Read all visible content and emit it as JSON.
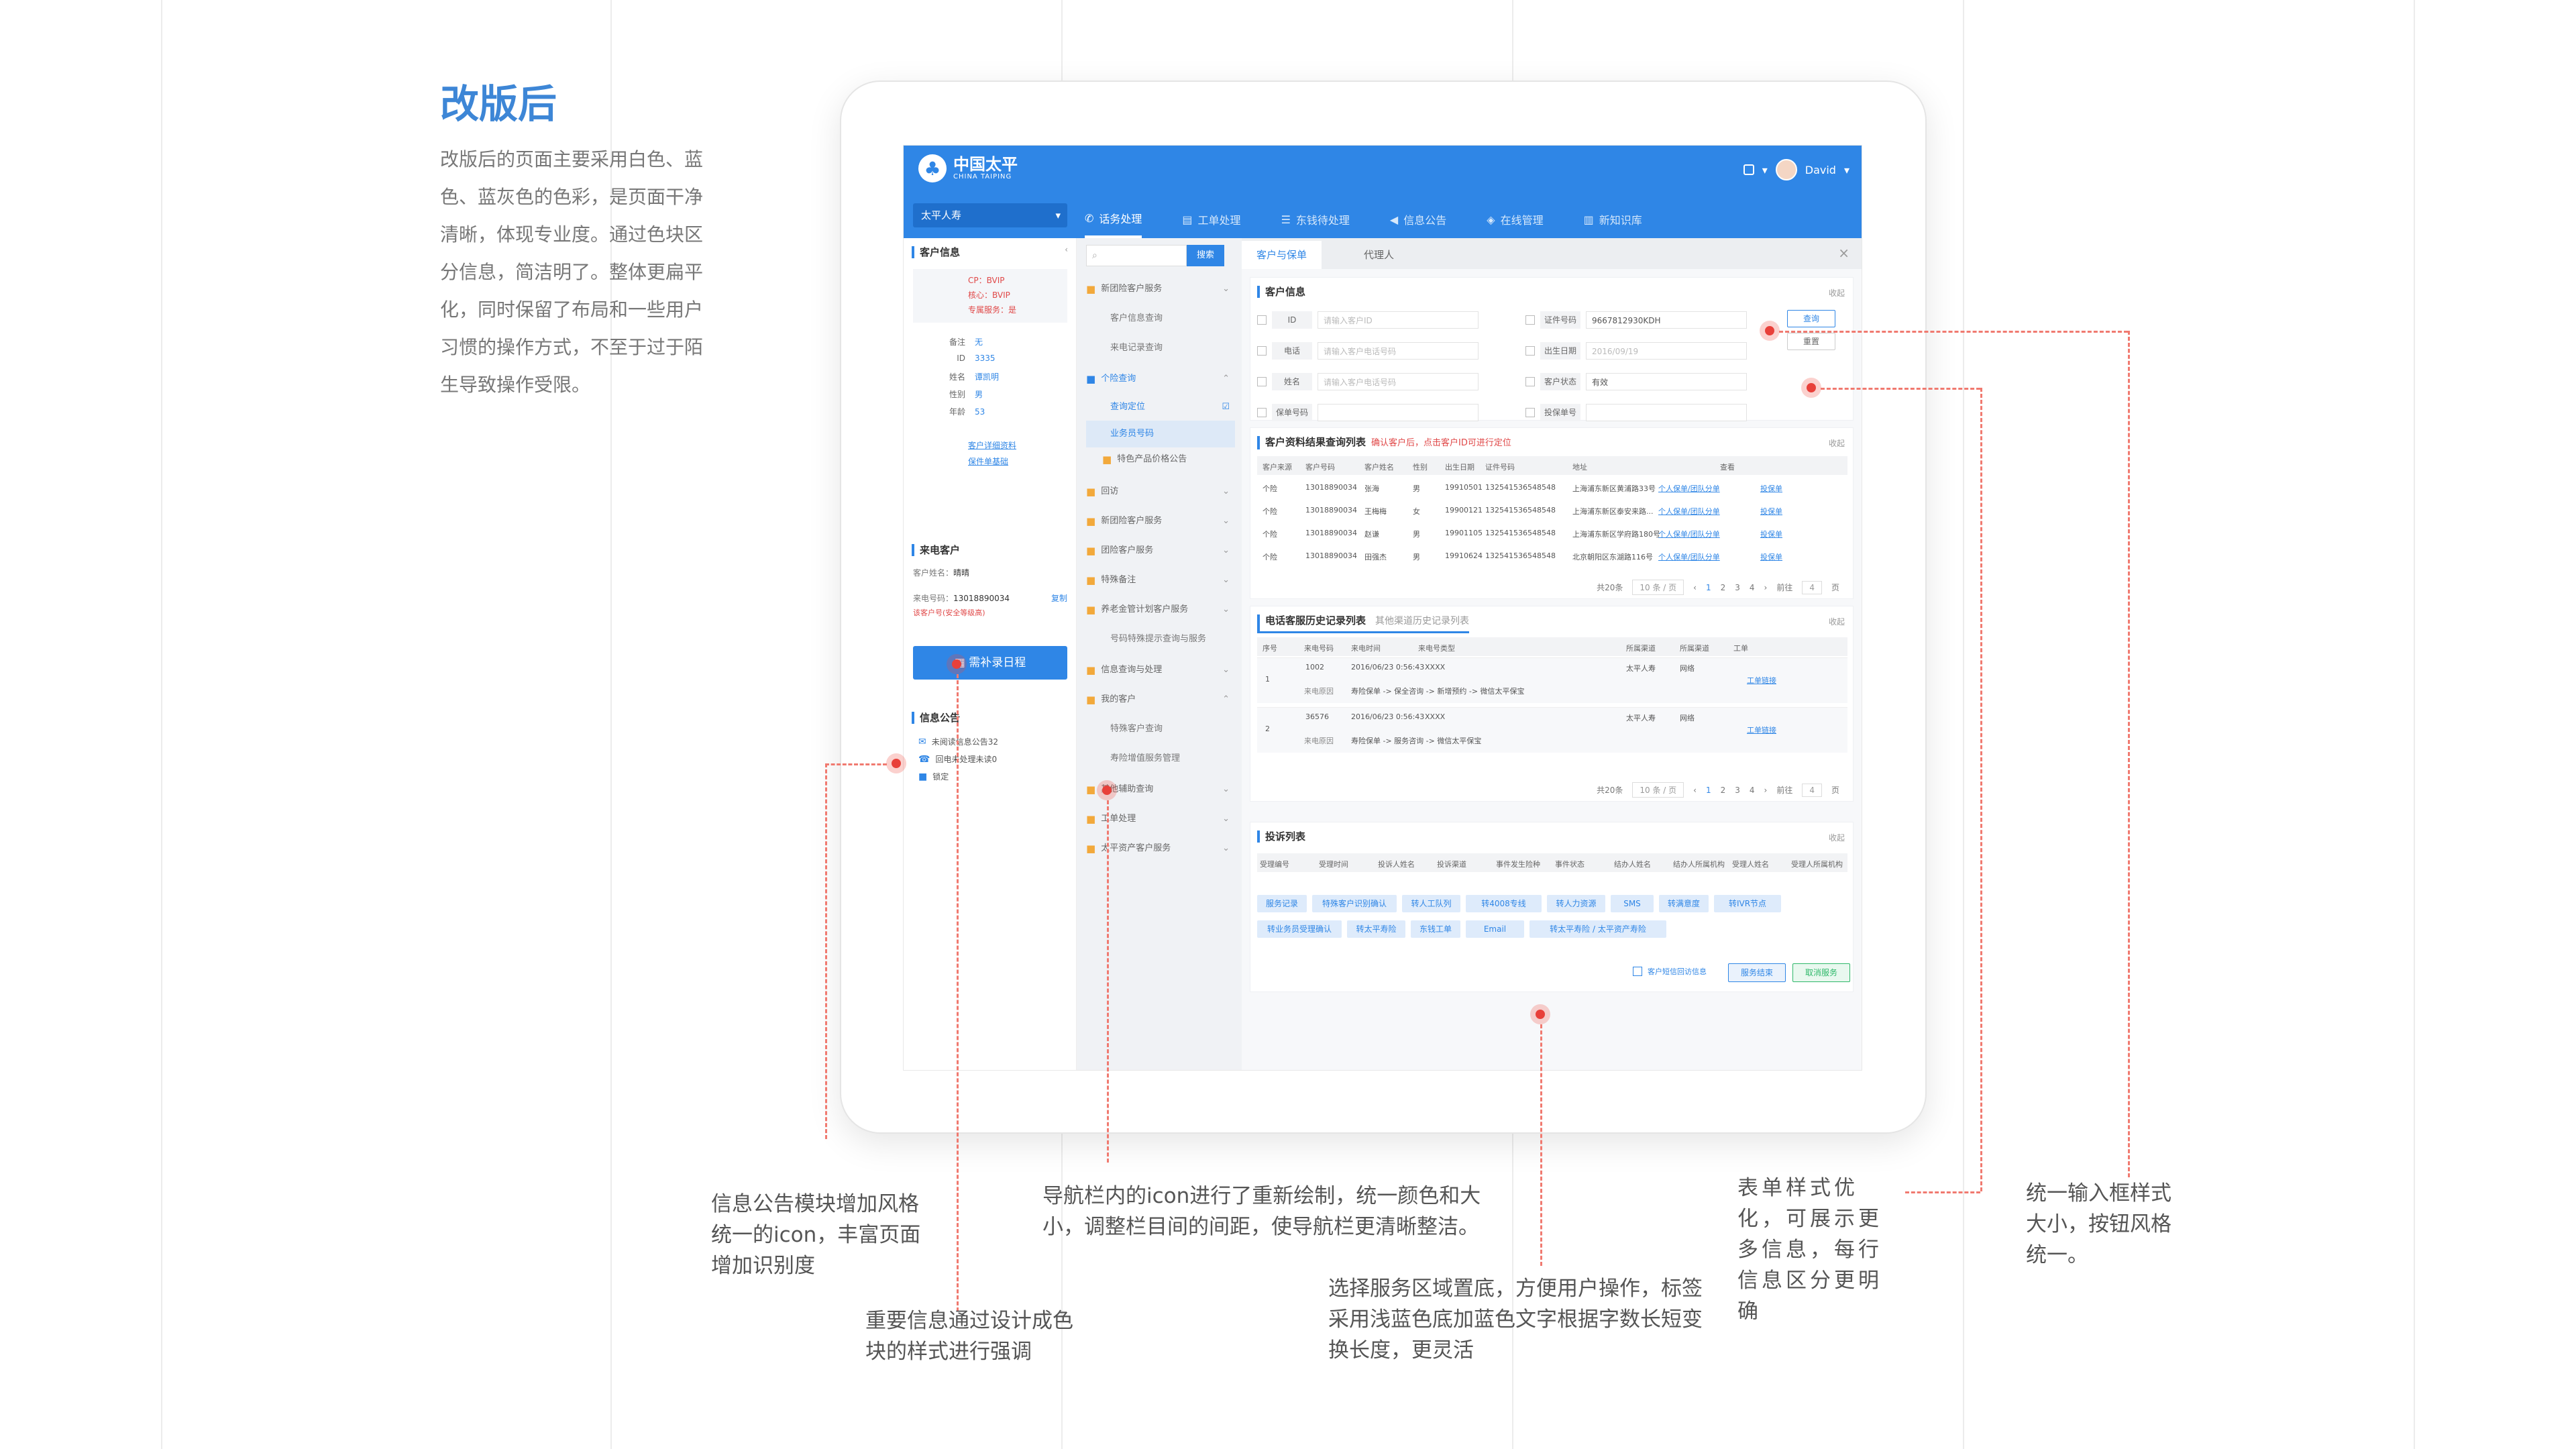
{
  "page": {
    "title": "改版后",
    "intro": "改版后的页面主要采用白色、蓝色、蓝灰色的色彩，是页面干净清晰，体现专业度。通过色块区分信息，简洁明了。整体更扁平化，同时保留了布局和一些用户习惯的操作方式，不至于过于陌生导致操作受限。",
    "accent_color": "#3d86d6",
    "annotation_color": "#e8403a"
  },
  "app": {
    "logo_cn": "中国太平",
    "logo_en": "CHINA TAIPING",
    "user": "David",
    "org_select": "太平人寿",
    "menu": [
      "话务处理",
      "工单处理",
      "东钱待处理",
      "信息公告",
      "在线管理",
      "新知识库"
    ],
    "menu_icons": [
      "phone-icon",
      "document-icon",
      "list-icon",
      "megaphone-icon",
      "shield-icon",
      "book-icon"
    ],
    "left": {
      "customer_info_title": "客户信息",
      "badges": [
        "CP：BVIP",
        "核心：BVIP",
        "专属服务：是"
      ],
      "fields": [
        {
          "k": "备注",
          "v": "无"
        },
        {
          "k": "ID",
          "v": "3335"
        },
        {
          "k": "姓名",
          "v": "谭凯明"
        },
        {
          "k": "性别",
          "v": "男"
        },
        {
          "k": "年龄",
          "v": "53"
        }
      ],
      "links": [
        "客户详细资料",
        "保件单基础"
      ],
      "caller_title": "来电客户",
      "caller_name_label": "客户姓名：",
      "caller_name": "晴晴",
      "caller_phone_label": "来电号码：",
      "caller_phone": "13018890034",
      "caller_copy": "复制",
      "caller_note": "该客户号(安全等级高)",
      "schedule_button": "需补录日程",
      "notice_title": "信息公告",
      "notices": [
        "未阅读信息公告32",
        "回电未处理未读0",
        "锁定"
      ]
    },
    "nav": {
      "search_button": "搜索",
      "items": [
        {
          "label": "新团险客户服务",
          "type": "folder"
        },
        {
          "label": "客户信息查询",
          "type": "sub"
        },
        {
          "label": "来电记录查询",
          "type": "sub"
        },
        {
          "label": "个险查询",
          "type": "folder-open"
        },
        {
          "label": "查询定位",
          "type": "selected"
        },
        {
          "label": "业务员号码",
          "type": "sub2"
        },
        {
          "label": "特色产品价格公告",
          "type": "folder-sub"
        },
        {
          "label": "回访",
          "type": "folder"
        },
        {
          "label": "新团险客户服务",
          "type": "folder"
        },
        {
          "label": "团险客户服务",
          "type": "folder"
        },
        {
          "label": "特殊备注",
          "type": "folder"
        },
        {
          "label": "养老金管计划客户服务",
          "type": "folder"
        },
        {
          "label": "号码特殊提示查询与服务",
          "type": "sub"
        },
        {
          "label": "信息查询与处理",
          "type": "folder"
        },
        {
          "label": "我的客户",
          "type": "folder"
        },
        {
          "label": "特殊客户查询",
          "type": "sub"
        },
        {
          "label": "寿险增值服务管理",
          "type": "sub"
        },
        {
          "label": "其他辅助查询",
          "type": "folder"
        },
        {
          "label": "工单处理",
          "type": "folder"
        },
        {
          "label": "太平资产客户服务",
          "type": "folder"
        }
      ]
    },
    "main": {
      "tabs": [
        "客户与保单",
        "代理人"
      ],
      "query": {
        "title": "客户信息",
        "collapse": "收起",
        "fields": [
          {
            "label": "ID",
            "value": "请输入客户ID",
            "filled": false
          },
          {
            "label": "电话",
            "value": "请输入客户电话号码",
            "filled": false
          },
          {
            "label": "姓名",
            "value": "请输入客户电话号码",
            "filled": false
          },
          {
            "label": "保单号码",
            "value": "",
            "filled": false
          },
          {
            "label": "证件号码",
            "value": "9667812930KDH",
            "filled": true
          },
          {
            "label": "出生日期",
            "value": "2016/09/19",
            "filled": true
          },
          {
            "label": "客户状态",
            "value": "有效",
            "filled": true
          },
          {
            "label": "投保单号",
            "value": "",
            "filled": false
          }
        ],
        "query_button": "查询",
        "reset_button": "重置"
      },
      "result": {
        "title": "客户资料结果查询列表",
        "note": "确认客户后，点击客户ID可进行定位",
        "headers": [
          "客户来源",
          "客户号码",
          "客户姓名",
          "性别",
          "出生日期",
          "证件号码",
          "地址",
          "查看"
        ],
        "rows": [
          [
            "个险",
            "13018890034",
            "张海",
            "男",
            "19910501",
            "13254153654854​8",
            "上海浦东新区黄浦路33号",
            "个人保单/团队分单",
            "投保单"
          ],
          [
            "个险",
            "13018890034",
            "王梅梅",
            "女",
            "19900121",
            "132541536548548",
            "上海浦东新区泰安来路...",
            "个人保单/团队分单",
            "投保单"
          ],
          [
            "个险",
            "13018890034",
            "赵谦",
            "男",
            "19901105",
            "132541536548548",
            "上海浦东新区学府路180号",
            "个人保单/团队分单",
            "投保单"
          ],
          [
            "个险",
            "13018890034",
            "田强杰",
            "男",
            "19910624",
            "132541536548548",
            "北京朝阳区东湖路116号",
            "个人保单/团队分单",
            "投保单"
          ]
        ],
        "pager": [
          "共20条",
          "10 条 / 页",
          "1",
          "2",
          "3",
          "4",
          "前往",
          "4",
          "页"
        ]
      },
      "history": {
        "title": "电话客服历史记录列表",
        "alt_title": "其他渠道历史记录列表",
        "headers": [
          "序号",
          "来电号码",
          "来电时间",
          "来电号类型",
          "所属渠道",
          "所属渠道",
          "工单"
        ],
        "rows": [
          {
            "no": "1",
            "num": "1002",
            "time": "2016/06/23 0:56:43",
            "type": "XXXX",
            "ch": "太平人寿",
            "ch2": "网络",
            "flow": "寿险保单 -> 保全咨询 -> 新增预约 -> 微信太平保宝",
            "link": "工单链接"
          },
          {
            "no": "2",
            "num": "36576",
            "time": "2016/06/23 0:56:43",
            "type": "XXXX",
            "ch": "太平人寿",
            "ch2": "网络",
            "flow": "寿险保单 -> 服务咨询 -> 微信太平保宝",
            "link": "工单链接"
          }
        ],
        "flow_label": "来电原因",
        "pager": [
          "共20条",
          "10 条 / 页",
          "1",
          "2",
          "3",
          "4",
          "前往",
          "4",
          "页"
        ]
      },
      "complaint": {
        "title": "投诉列表",
        "headers": [
          "受理编号",
          "受理时间",
          "投诉人姓名",
          "投诉渠道",
          "事件发生险种",
          "事件状态",
          "结办人姓名",
          "结办人所属机构",
          "受理人姓名",
          "受理人所属机构"
        ],
        "tags": [
          "服务记录",
          "特殊客户识别确认",
          "转人工队列",
          "转4008专线",
          "转人力资源",
          "SMS",
          "转满意度",
          "转IVR节点",
          "转业务员受理确认",
          "转太平寿险",
          "东钱工单",
          "Email",
          "转太平寿险 / 太平资产寿险"
        ],
        "sms_check": "客户短信回访信息",
        "finish_button": "服务结束",
        "cancel_button": "取消服务"
      }
    }
  },
  "annotations": [
    "信息公告模块增加风格统一的icon，丰富页面增加识别度",
    "重要信息通过设计成色块的样式进行强调",
    "导航栏内的icon进行了重新绘制，统一颜色和大小，调整栏目间的间距，使导航栏更清晰整洁。",
    "选择服务区域置底，方便用户操作，标签采用浅蓝色底加蓝色文字根据字数长短变换长度，更灵活",
    "表单样式优化，可展示更多信息，每行信息区分更明确",
    "统一输入框样式大小，按钮风格统一。"
  ]
}
